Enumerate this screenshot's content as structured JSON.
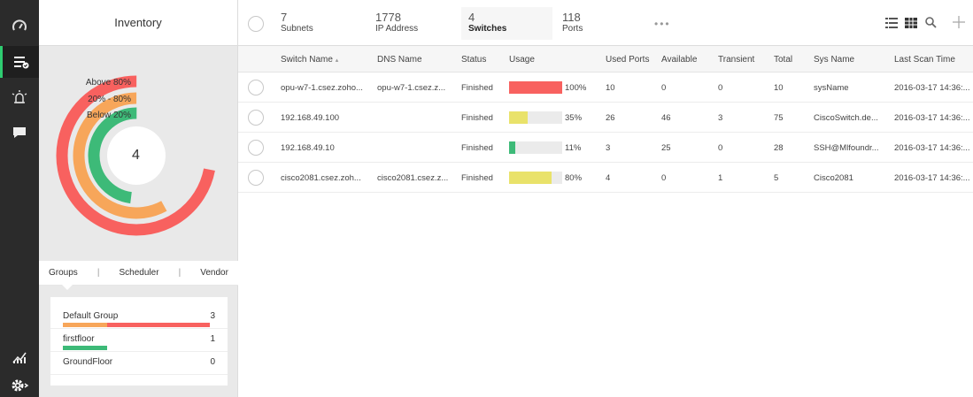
{
  "app": {
    "title": "Inventory"
  },
  "rail": {
    "items": [
      {
        "icon": "speedometer-icon"
      },
      {
        "icon": "list-check-icon",
        "active": true
      },
      {
        "icon": "alarm-icon"
      },
      {
        "icon": "chat-icon"
      },
      {
        "icon": "reports-chart-icon"
      },
      {
        "icon": "settings-gear-icon"
      }
    ]
  },
  "summary": {
    "legend": [
      "Above 80%",
      "20% - 80%",
      "Below 20%"
    ],
    "total": "4",
    "colors": {
      "above": "#f8615f",
      "mid": "#f7a65a",
      "below": "#3dba78"
    },
    "ring_fractions": {
      "above": 0.72,
      "mid": 0.58,
      "below": 0.48
    }
  },
  "subtabs": [
    "Groups",
    "Scheduler",
    "Vendor"
  ],
  "groups": [
    {
      "name": "Default Group",
      "count": "3",
      "segments": [
        {
          "color": "#f7a65a",
          "frac": 0.3
        },
        {
          "color": "#f8615f",
          "frac": 0.7
        }
      ]
    },
    {
      "name": "firstfloor",
      "count": "1",
      "segments": [
        {
          "color": "#3dba78",
          "frac": 0.3
        }
      ]
    },
    {
      "name": "GroundFloor",
      "count": "0",
      "segments": []
    }
  ],
  "stats": [
    {
      "num": "7",
      "label": "Subnets"
    },
    {
      "num": "1778",
      "label": "IP Address"
    },
    {
      "num": "4",
      "label": "Switches",
      "active": true
    },
    {
      "num": "118",
      "label": "Ports"
    }
  ],
  "more_label": "•••",
  "table": {
    "headers": [
      "Switch Name",
      "DNS Name",
      "Status",
      "Usage",
      "Used Ports",
      "Available",
      "Transient",
      "Total",
      "Sys Name",
      "Last Scan Time"
    ],
    "sort_indicator": "▴",
    "rows": [
      {
        "switch": "opu-w7-1.csez.zoho...",
        "dns": "opu-w7-1.csez.z...",
        "status": "Finished",
        "usage": 1.0,
        "usage_label": "100%",
        "usage_color": "#f8615f",
        "used": "10",
        "available": "0",
        "transient": "0",
        "total": "10",
        "sys": "sysName",
        "scan": "2016-03-17 14:36:..."
      },
      {
        "switch": "192.168.49.100",
        "dns": "",
        "status": "Finished",
        "usage": 0.35,
        "usage_label": "35%",
        "usage_color": "#e9e26a",
        "used": "26",
        "available": "46",
        "transient": "3",
        "total": "75",
        "sys": "CiscoSwitch.de...",
        "scan": "2016-03-17 14:36:..."
      },
      {
        "switch": "192.168.49.10",
        "dns": "",
        "status": "Finished",
        "usage": 0.11,
        "usage_label": "11%",
        "usage_color": "#3dba78",
        "used": "3",
        "available": "25",
        "transient": "0",
        "total": "28",
        "sys": "SSH@Mlfoundr...",
        "scan": "2016-03-17 14:36:..."
      },
      {
        "switch": "cisco2081.csez.zoh...",
        "dns": "cisco2081.csez.z...",
        "status": "Finished",
        "usage": 0.8,
        "usage_label": "80%",
        "usage_color": "#e9e26a",
        "used": "4",
        "available": "0",
        "transient": "1",
        "total": "5",
        "sys": "Cisco2081",
        "scan": "2016-03-17 14:36:..."
      }
    ]
  }
}
